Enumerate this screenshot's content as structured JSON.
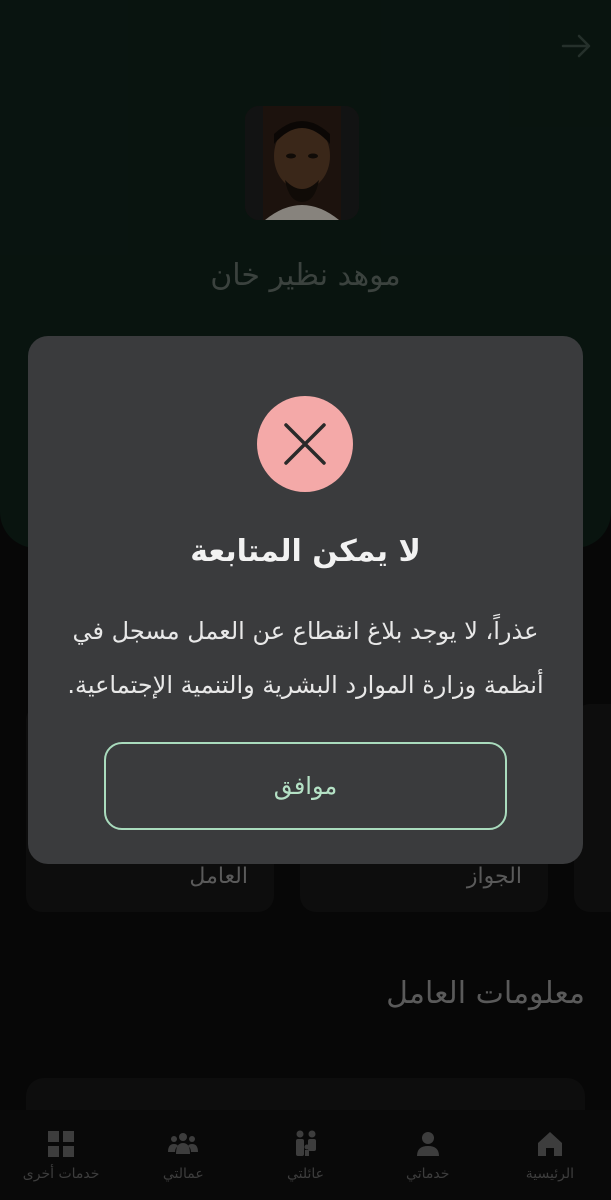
{
  "background": {
    "worker_name": "موهد نظير خان",
    "cards": [
      {
        "label": "العامل"
      },
      {
        "label": "الجواز"
      }
    ],
    "section_title": "معلومات العامل"
  },
  "bottom_nav": {
    "items": [
      {
        "label": "الرئيسية",
        "icon": "home-icon"
      },
      {
        "label": "خدماتي",
        "icon": "person-icon"
      },
      {
        "label": "عائلتي",
        "icon": "family-icon"
      },
      {
        "label": "عمالتي",
        "icon": "workers-icon"
      },
      {
        "label": "خدمات أخرى",
        "icon": "grid-icon"
      }
    ]
  },
  "dialog": {
    "icon": "close-icon",
    "title": "لا يمكن المتابعة",
    "message_line1": "عذراً، لا يوجد بلاغ انقطاع عن العمل مسجل في",
    "message_line2": "أنظمة وزارة الموارد البشرية والتنمية الإجتماعية.",
    "ok_label": "موافق"
  },
  "colors": {
    "dialog_bg": "#3a3b3d",
    "error_circle": "#f4a9a8",
    "button_border": "#a9dbbd",
    "header_bg": "#0e1f18"
  }
}
